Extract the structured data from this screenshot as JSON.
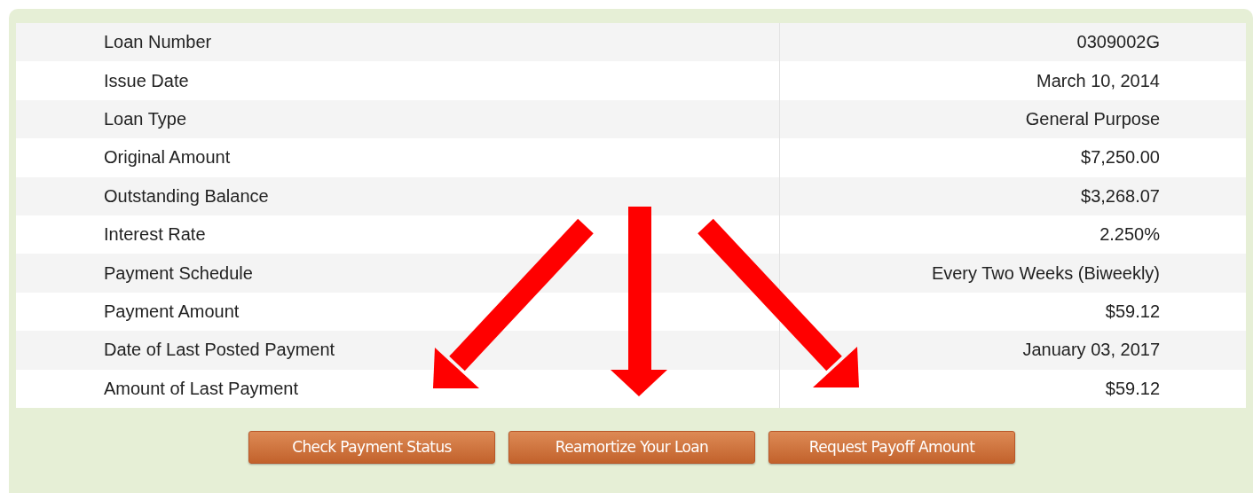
{
  "loan_details": [
    {
      "label": "Loan Number",
      "value": "0309002G"
    },
    {
      "label": "Issue Date",
      "value": "March 10, 2014"
    },
    {
      "label": "Loan Type",
      "value": "General Purpose"
    },
    {
      "label": "Original Amount",
      "value": "$7,250.00"
    },
    {
      "label": "Outstanding Balance",
      "value": "$3,268.07"
    },
    {
      "label": "Interest Rate",
      "value": "2.250%"
    },
    {
      "label": "Payment Schedule",
      "value": "Every Two Weeks (Biweekly)"
    },
    {
      "label": "Payment Amount",
      "value": "$59.12"
    },
    {
      "label": "Date of Last Posted Payment",
      "value": "January 03, 2017"
    },
    {
      "label": "Amount of Last Payment",
      "value": "$59.12"
    }
  ],
  "buttons": [
    "Check Payment Status",
    "Reamortize Your Loan",
    "Request Payoff Amount"
  ],
  "annotations": [
    {
      "kind": "arrow-down-left"
    },
    {
      "kind": "arrow-down"
    },
    {
      "kind": "arrow-down-right"
    }
  ]
}
